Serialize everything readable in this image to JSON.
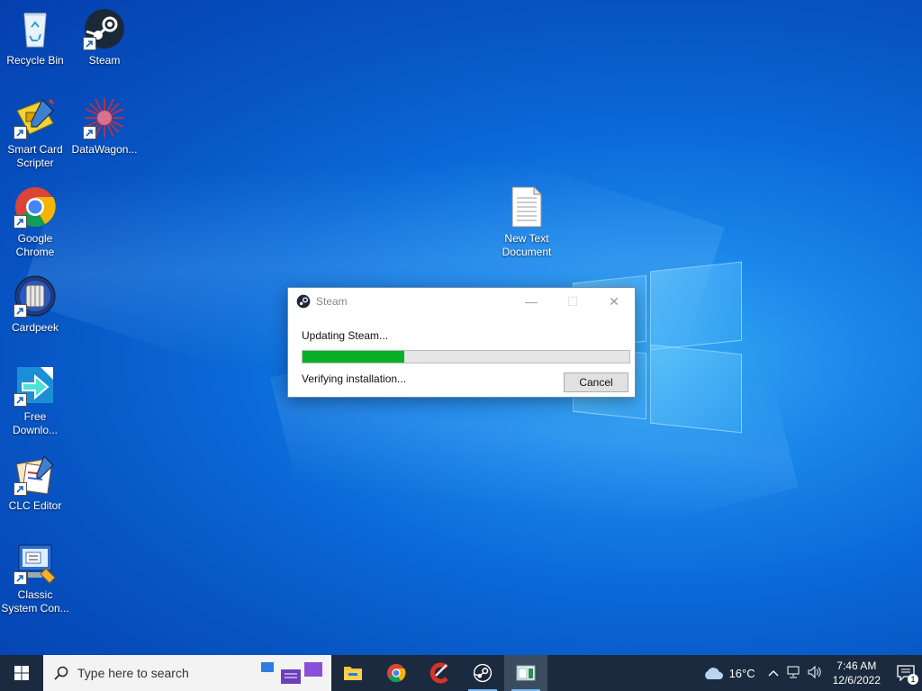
{
  "desktop": {
    "icons": [
      {
        "label": "Recycle Bin",
        "icon": "recycle-bin-icon"
      },
      {
        "label": "Steam",
        "icon": "steam-icon"
      },
      {
        "label": "Smart Card Scripter",
        "icon": "smart-card-scripter-icon"
      },
      {
        "label": "DataWagon...",
        "icon": "datawagon-icon"
      },
      {
        "label": "Google Chrome",
        "icon": "chrome-icon"
      },
      {
        "label": "Cardpeek",
        "icon": "cardpeek-icon"
      },
      {
        "label": "Free Downlo...",
        "icon": "free-download-icon"
      },
      {
        "label": "CLC Editor",
        "icon": "clc-editor-icon"
      },
      {
        "label": "Classic System Con...",
        "icon": "classic-system-control-icon"
      },
      {
        "label": "New Text Document",
        "icon": "text-document-icon"
      }
    ]
  },
  "dialog": {
    "title": "Steam",
    "status": "Updating Steam...",
    "progress_percent": 31,
    "substatus": "Verifying installation...",
    "cancel_label": "Cancel"
  },
  "taskbar": {
    "search_placeholder": "Type here to search",
    "apps": [
      "file-explorer-icon",
      "chrome-icon",
      "ccleaner-icon",
      "steam-icon",
      "app-window-icon"
    ],
    "weather_temp": "16°C",
    "time": "7:46 AM",
    "date": "12/6/2022",
    "notification_count": "1"
  },
  "colors": {
    "progress_fill": "#06b025",
    "taskbar_bg": "#1b2a3e",
    "desktop_blue": "#0b6ad8"
  }
}
